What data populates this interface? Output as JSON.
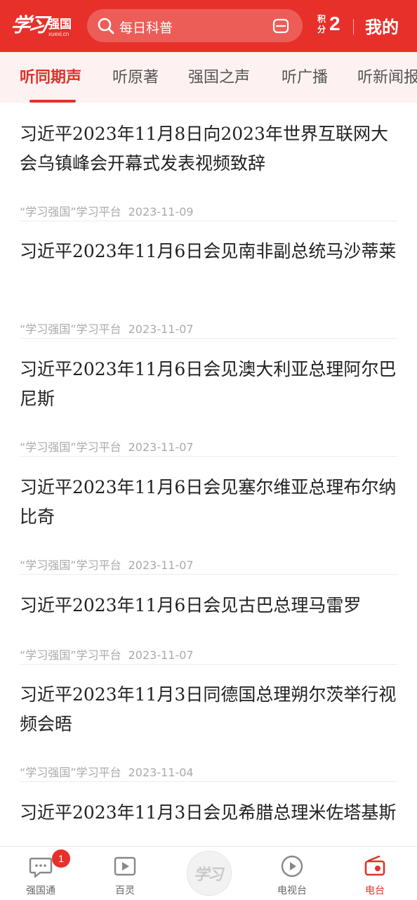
{
  "header": {
    "logo_script": "学习",
    "logo_brand": "强国",
    "logo_domain": "xuexi.cn",
    "search_placeholder": "每日科普",
    "points_label": "积分",
    "points_value": "2",
    "mine_label": "我的",
    "colors": {
      "brand": "#e8302a",
      "accent": "#e0322b"
    }
  },
  "tabs": [
    {
      "label": "听同期声",
      "active": true
    },
    {
      "label": "听原著"
    },
    {
      "label": "强国之声"
    },
    {
      "label": "听广播"
    },
    {
      "label": "听新闻报"
    }
  ],
  "articles": [
    {
      "title": "习近平2023年11月8日向2023年世界互联网大会乌镇峰会开幕式发表视频致辞",
      "source": "“学习强国”学习平台",
      "date": "2023-11-09"
    },
    {
      "title": "习近平2023年11月6日会见南非副总统马沙蒂莱",
      "source": "“学习强国”学习平台",
      "date": "2023-11-07"
    },
    {
      "title": "习近平2023年11月6日会见澳大利亚总理阿尔巴尼斯",
      "source": "“学习强国”学习平台",
      "date": "2023-11-07"
    },
    {
      "title": "习近平2023年11月6日会见塞尔维亚总理布尔纳比奇",
      "source": "“学习强国”学习平台",
      "date": "2023-11-07"
    },
    {
      "title": "习近平2023年11月6日会见古巴总理马雷罗",
      "source": "“学习强国”学习平台",
      "date": "2023-11-07"
    },
    {
      "title": "习近平2023年11月3日同德国总理朔尔茨举行视频会晤",
      "source": "“学习强国”学习平台",
      "date": "2023-11-04"
    },
    {
      "title": "习近平2023年11月3日会见希腊总理米佐塔基斯",
      "source": "",
      "date": ""
    }
  ],
  "bottom_nav": {
    "items": [
      {
        "label": "强国通",
        "icon": "chat-icon",
        "badge": "1"
      },
      {
        "label": "百灵",
        "icon": "play-square-icon"
      },
      {
        "label": "学习",
        "icon": "xuexi-logo-icon"
      },
      {
        "label": "电视台",
        "icon": "play-circle-icon"
      },
      {
        "label": "电台",
        "icon": "radio-icon",
        "active": true
      }
    ]
  }
}
